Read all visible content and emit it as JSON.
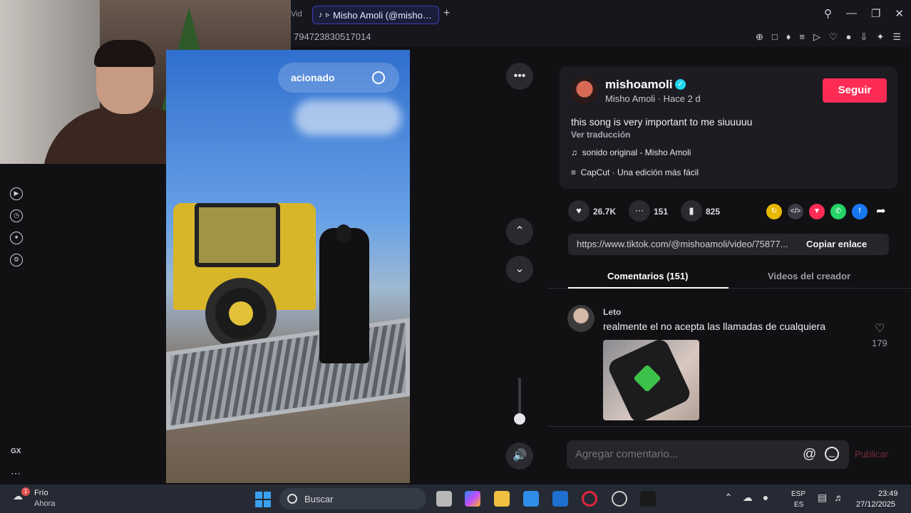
{
  "browser": {
    "tab_prev_label": "Vid",
    "active_tab_label": "Misho Amoli (@misho…",
    "url": "794723830517014",
    "window_controls": [
      "search-icon",
      "minimize-icon",
      "maximize-icon",
      "close-icon"
    ]
  },
  "video": {
    "search_text": "acionado"
  },
  "post": {
    "username": "mishoamoli",
    "display_line": "Misho Amoli · Hace 2 d",
    "follow_label": "Seguir",
    "description": "this song is very important to me siuuuuu",
    "translate_label": "Ver traducción",
    "sound": "sonido original - Misho Amoli",
    "capcut": "CapCut · Una edición más fácil",
    "likes": "26.7K",
    "comments_count": "151",
    "saves": "825",
    "link": "https://www.tiktok.com/@mishoamoli/video/75877...",
    "copy_label": "Copiar enlace",
    "accent_color": "#fe2c55"
  },
  "tabs": {
    "comments": "Comentarios (151)",
    "creator_videos": "Videos del creador"
  },
  "comment": {
    "author": "Leto",
    "text": "realmente el no acepta las llamadas de cualquiera",
    "likes": "179"
  },
  "composer": {
    "placeholder": "Agregar comentario...",
    "publish_label": "Publicar"
  },
  "sidebar": {
    "gx_label": "GX"
  },
  "taskbar": {
    "weather_badge": "1",
    "weather_title": "Frío",
    "weather_sub": "Ahora",
    "search_label": "Buscar",
    "lang_top": "ESP",
    "lang_bottom": "ES",
    "time": "23:49",
    "date": "27/12/2025"
  }
}
